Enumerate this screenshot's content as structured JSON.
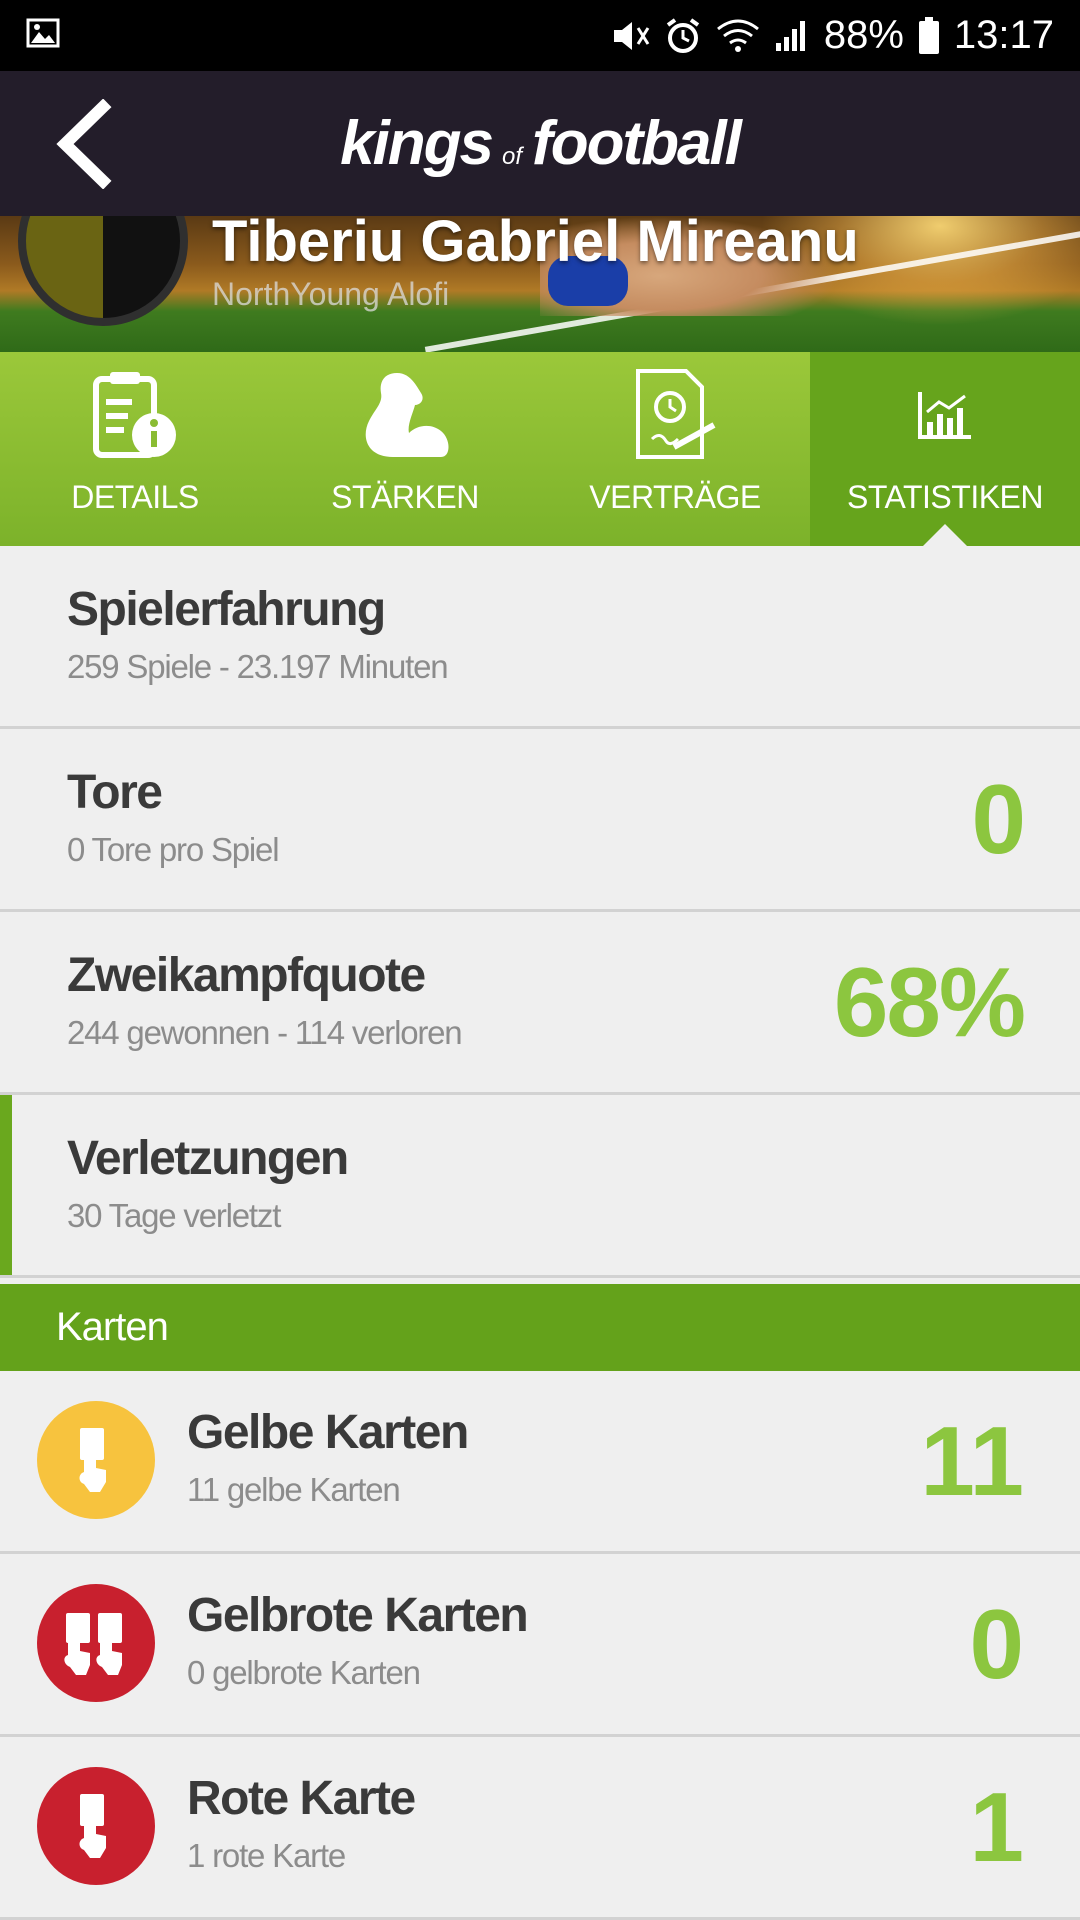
{
  "status_bar": {
    "battery": "88%",
    "time": "13:17",
    "icons": [
      "image-icon",
      "mute-icon",
      "alarm-icon",
      "wifi-icon",
      "signal-icon",
      "battery-icon"
    ]
  },
  "app_bar": {
    "logo_part1": "kings",
    "logo_part2": "of",
    "logo_part3": "football"
  },
  "player": {
    "name": "Tiberiu Gabriel Mireanu",
    "club": "NorthYoung Alofi"
  },
  "tabs": [
    {
      "label": "DETAILS",
      "icon": "document-info-icon"
    },
    {
      "label": "STÄRKEN",
      "icon": "muscle-icon"
    },
    {
      "label": "VERTRÄGE",
      "icon": "contract-icon"
    },
    {
      "label": "STATISTIKEN",
      "icon": "chart-icon",
      "active": true
    }
  ],
  "stats": [
    {
      "title": "Spielerfahrung",
      "sub": "259 Spiele - 23.197 Minuten",
      "value": ""
    },
    {
      "title": "Tore",
      "sub": "0 Tore pro Spiel",
      "value": "0"
    },
    {
      "title": "Zweikampfquote",
      "sub": "244 gewonnen - 114 verloren",
      "value": "68%"
    },
    {
      "title": "Verletzungen",
      "sub": "30 Tage verletzt",
      "value": ""
    }
  ],
  "cards_section": {
    "header": "Karten",
    "items": [
      {
        "title": "Gelbe Karten",
        "sub": "11 gelbe Karten",
        "value": "11",
        "color": "#f7c33e"
      },
      {
        "title": "Gelbrote Karten",
        "sub": "0 gelbrote Karten",
        "value": "0",
        "color": "#c8202e"
      },
      {
        "title": "Rote Karte",
        "sub": "1 rote Karte",
        "value": "1",
        "color": "#c8202e"
      }
    ]
  },
  "colors": {
    "accent_green": "#8cc63f",
    "tab_green": "#7cb22a",
    "active_tab_green": "#66a41c",
    "app_bar": "#231d2a"
  }
}
